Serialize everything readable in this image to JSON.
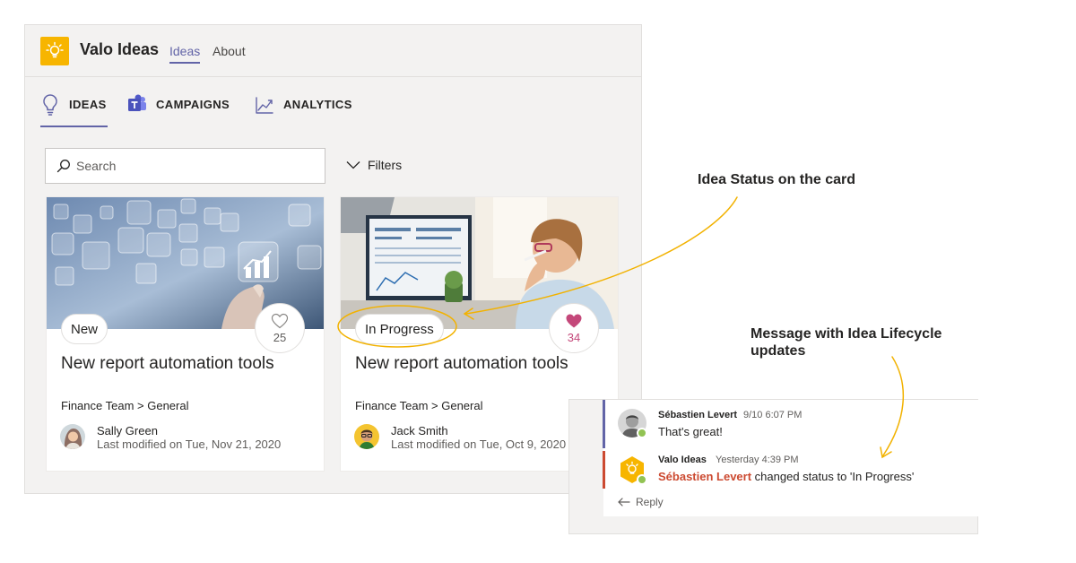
{
  "app": {
    "title": "Valo Ideas",
    "top_tabs": [
      {
        "label": "Ideas",
        "active": true
      },
      {
        "label": "About",
        "active": false
      }
    ],
    "nav": [
      {
        "label": "IDEAS",
        "icon": "lightbulb-icon",
        "active": true
      },
      {
        "label": "CAMPAIGNS",
        "icon": "teams-icon",
        "active": false
      },
      {
        "label": "ANALYTICS",
        "icon": "line-chart-icon",
        "active": false
      }
    ],
    "search": {
      "placeholder": "Search",
      "value": ""
    },
    "filters_label": "Filters",
    "accent": "#6264a7",
    "logo_color": "#f7b500"
  },
  "cards": [
    {
      "status": "New",
      "likes": "25",
      "liked": false,
      "title": "New report automation tools",
      "team": "Finance Team > General",
      "author": "Sally Green",
      "modified": "Last modified on Tue, Nov 21, 2020"
    },
    {
      "status": "In Progress",
      "likes": "34",
      "liked": true,
      "title": "New report automation tools",
      "team": "Finance Team > General",
      "author": "Jack Smith",
      "modified": "Last modified on Tue, Oct 9, 2020"
    }
  ],
  "annotations": {
    "status_card": "Idea Status on the card",
    "lifecycle": "Message with Idea Lifecycle updates",
    "arrow_color": "#f2b200"
  },
  "chat": {
    "messages": [
      {
        "sender": "Sébastien Levert",
        "time": "9/10 6:07 PM",
        "text": "That's great!"
      },
      {
        "sender": "Valo Ideas",
        "time": "Yesterday 4:39 PM",
        "mention": "Sébastien Levert",
        "text": "changed status to 'In Progress'"
      }
    ],
    "reply_label": "Reply",
    "mention_color": "#cc4a31"
  }
}
